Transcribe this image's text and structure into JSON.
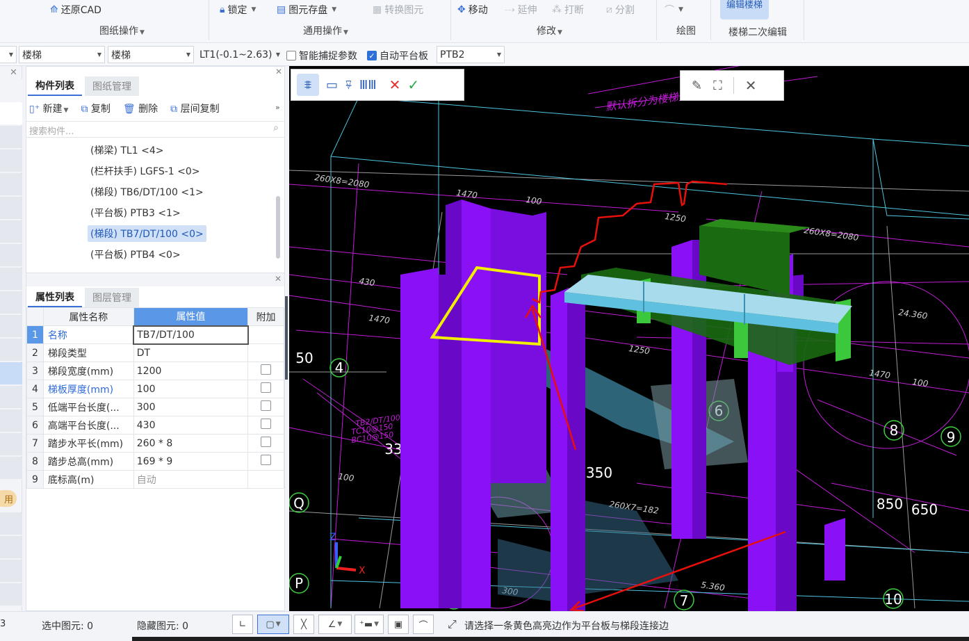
{
  "ribbon": {
    "restore_cad": "还原CAD",
    "group_drawing_ops": "图纸操作",
    "lock": "锁定",
    "save_elements": "图元存盘",
    "convert_elements": "转换图元",
    "group_common_ops": "通用操作",
    "move": "移动",
    "extend": "延伸",
    "break": "打断",
    "split": "分割",
    "group_modify": "修改",
    "group_draw": "绘图",
    "edit_stairs": "编辑楼梯",
    "group_stair_edit": "楼梯二次编辑"
  },
  "toolbar": {
    "category_1": "楼梯",
    "category_2": "楼梯",
    "floor_select": "LT1(-0.1~2.63)",
    "smart_snap_label": "智能捕捉参数",
    "smart_snap_checked": false,
    "auto_platform_label": "自动平台板",
    "auto_platform_checked": true,
    "platform_select": "PTB2"
  },
  "left_strip": {
    "use_badge": "用",
    "status_prefix": "3"
  },
  "component_panel": {
    "tab_component_list": "构件列表",
    "tab_drawing_mgmt": "图纸管理",
    "new_btn": "新建",
    "copy_btn": "复制",
    "delete_btn": "删除",
    "floor_copy_btn": "层间复制",
    "search_placeholder": "搜索构件...",
    "items": [
      {
        "label": "(梯梁) TL1 <4>"
      },
      {
        "label": "(栏杆扶手) LGFS-1 <0>"
      },
      {
        "label": "(梯段) TB6/DT/100 <1>"
      },
      {
        "label": "(平台板) PTB3 <1>"
      },
      {
        "label": "(梯段) TB7/DT/100 <0>"
      },
      {
        "label": "(平台板) PTB4 <0>"
      }
    ],
    "selected_index": 4
  },
  "property_panel": {
    "tab_property_list": "属性列表",
    "tab_layer_mgmt": "图层管理",
    "col_name": "属性名称",
    "col_value": "属性值",
    "col_extra": "附加",
    "rows": [
      {
        "num": "1",
        "name": "名称",
        "value": "TB7/DT/100"
      },
      {
        "num": "2",
        "name": "梯段类型",
        "value": "DT"
      },
      {
        "num": "3",
        "name": "梯段宽度(mm)",
        "value": "1200"
      },
      {
        "num": "4",
        "name": "梯板厚度(mm)",
        "value": "100"
      },
      {
        "num": "5",
        "name": "低端平台长度(...",
        "value": "300"
      },
      {
        "num": "6",
        "name": "高端平台长度(...",
        "value": "430"
      },
      {
        "num": "7",
        "name": "踏步水平长(mm)",
        "value": "260 * 8"
      },
      {
        "num": "8",
        "name": "踏步总高(mm)",
        "value": "169 * 9"
      },
      {
        "num": "9",
        "name": "底标高(m)",
        "value": "自动"
      }
    ]
  },
  "viewport": {
    "cad_text_question": "默认拆分为楼梯文件(是/否):",
    "dim_1": "260X8=2080",
    "dim_2": "1470",
    "dim_3": "100",
    "dim_4": "1250",
    "dim_5": "260X8=2080",
    "dim_6": "430",
    "dim_7": "1470",
    "dim_8": "1250",
    "dim_9": "260X7=182",
    "dim_10": "24.360",
    "dim_11": "1470",
    "dim_12": "100",
    "dim_13": "300",
    "dim_14": "5.360",
    "dim_15": "100",
    "dim_16": "100",
    "note_tb": "TB2/DT/100",
    "note_tc": "TC10@150",
    "note_bc": "BC10@150",
    "axis_4": "4",
    "axis_6": "6",
    "axis_8": "8",
    "axis_9": "9",
    "axis_10": "10",
    "axis_q": "Q",
    "axis_p": "P",
    "axis_p2": "P",
    "axis_7": "7",
    "label_33": "33",
    "label_350": "350",
    "label_850": "850",
    "label_650": "650",
    "label_50": "50",
    "axis_z": "Z",
    "axis_x": "X"
  },
  "status": {
    "selected_label": "选中图元:",
    "selected_count": "0",
    "hidden_label": "隐藏图元:",
    "hidden_count": "0",
    "prompt": "请选择一条黄色高亮边作为平台板与梯段连接边"
  },
  "colors": {
    "accent": "#3a6fd8",
    "selected_row": "#5a97e6",
    "purple": "#8a10f5",
    "green": "#1a7a12",
    "cyan": "#79d8f0",
    "yellow": "#f0f000",
    "red": "#e8100c",
    "magenta": "#c21cd8"
  }
}
